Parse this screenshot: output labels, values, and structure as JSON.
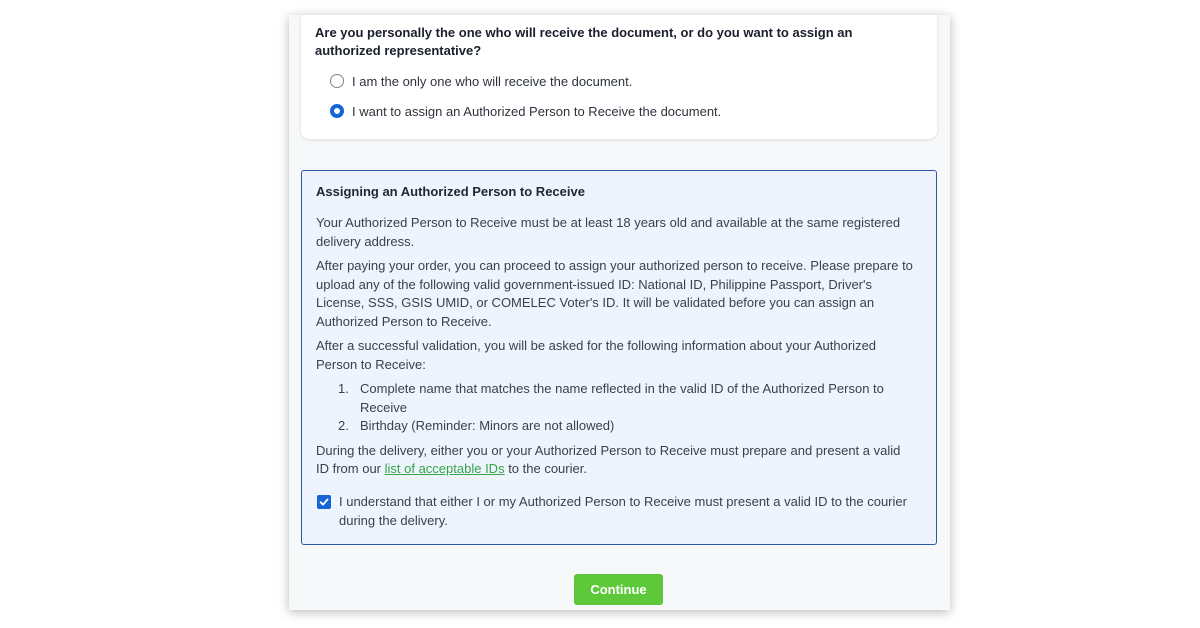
{
  "question": {
    "text": "Are you personally the one who will receive the document, or do you want to assign an authorized representative?",
    "options": [
      {
        "label": "I am the only one who will receive the document.",
        "selected": false
      },
      {
        "label": "I want to assign an Authorized Person to Receive the document.",
        "selected": true
      }
    ]
  },
  "info": {
    "title": "Assigning an Authorized Person to Receive",
    "para1": "Your Authorized Person to Receive must be at least 18 years old and available at the same registered delivery address.",
    "para2": "After paying your order, you can proceed to assign your authorized person to receive. Please prepare to upload any of the following valid government-issued ID: National ID, Philippine Passport, Driver's License, SSS, GSIS UMID, or COMELEC Voter's ID. It will be validated before you can assign an Authorized Person to Receive.",
    "para3": "After a successful validation, you will be asked for the following information about your Authorized Person to Receive:",
    "list": [
      {
        "num": "1.",
        "text": "Complete name that matches the name reflected in the valid ID of the Authorized Person to Receive"
      },
      {
        "num": "2.",
        "text": "Birthday (Reminder: Minors are not allowed)"
      }
    ],
    "para4_before": "During the delivery, either you or your Authorized Person to Receive must prepare and present a valid ID from our ",
    "para4_link": "list of acceptable IDs",
    "para4_after": " to the courier."
  },
  "acknowledgement": {
    "label": "I understand that either I or my Authorized Person to Receive must present a valid ID to the courier during the delivery.",
    "checked": true
  },
  "continue_label": "Continue",
  "colors": {
    "primary_blue": "#1565d8",
    "info_border": "#2c5aa8",
    "info_bg": "#edf4fd",
    "link_green": "#39a24a",
    "button_green": "#5cc83a"
  }
}
